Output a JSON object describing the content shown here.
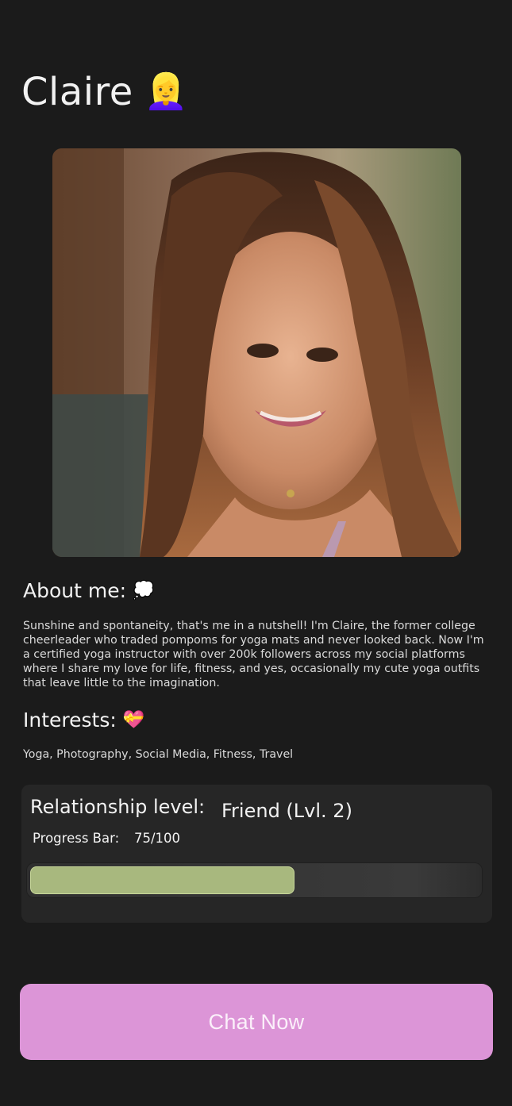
{
  "profile": {
    "name": "Claire",
    "name_emoji": "👱‍♀️"
  },
  "about": {
    "heading": "About me:",
    "heading_emoji": "💭",
    "text": "Sunshine and spontaneity, that's me in a nutshell! I'm Claire, the former college cheerleader who traded pompoms for yoga mats and never looked back. Now I'm a certified yoga instructor with over 200k followers across my social platforms where I share my love for life, fitness, and yes, occasionally my cute yoga outfits that leave little to the imagination."
  },
  "interests": {
    "heading": "Interests:",
    "heading_emoji": "💝",
    "text": "Yoga, Photography, Social Media, Fitness, Travel"
  },
  "relationship": {
    "label": "Relationship level:",
    "value": "Friend (Lvl. 2)",
    "progress_label": "Progress Bar:",
    "progress_text": "75/100",
    "progress_fraction": 0.59
  },
  "actions": {
    "chat_label": "Chat Now"
  },
  "colors": {
    "background": "#1b1b1b",
    "card": "#262626",
    "progress_fill": "#a8b87e",
    "button": "#dc95d7"
  }
}
